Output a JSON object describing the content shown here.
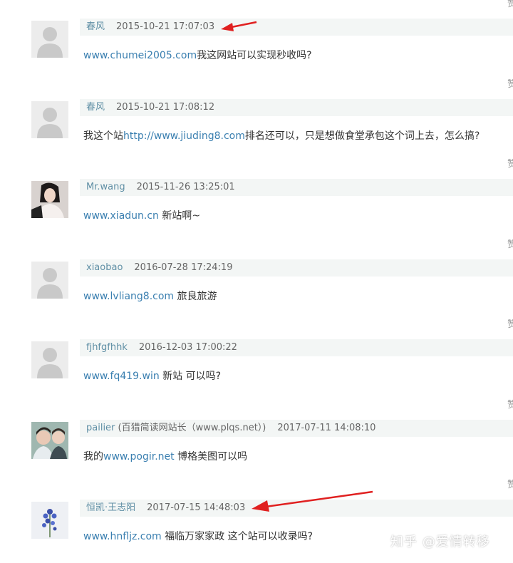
{
  "reply_label": "赞",
  "comments": [
    {
      "user": "春风",
      "note": "",
      "time": "2015-10-21 17:07:03",
      "pre": "",
      "link": "www.chumei2005.com",
      "post": "我这网站可以实现秒收吗?",
      "avatar": "default-avatar"
    },
    {
      "user": "春风",
      "note": "",
      "time": "2015-10-21 17:08:12",
      "pre": "我这个站",
      "link": "http://www.jiuding8.com",
      "post": "排名还可以，只是想做食堂承包这个词上去，怎么搞?",
      "avatar": "default-avatar"
    },
    {
      "user": "Mr.wang",
      "note": "",
      "time": "2015-11-26 13:25:01",
      "pre": "",
      "link": "www.xiadun.cn",
      "post": " 新站啊~",
      "avatar": "photo-avatar-woman"
    },
    {
      "user": "xiaobao",
      "note": "",
      "time": "2016-07-28 17:24:19",
      "pre": "",
      "link": "www.lvliang8.com",
      "post": " 旅良旅游",
      "avatar": "default-avatar"
    },
    {
      "user": "fjhfgfhhk",
      "note": "",
      "time": "2016-12-03 17:00:22",
      "pre": "",
      "link": "www.fq419.win",
      "post": " 新站 可以吗?",
      "avatar": "default-avatar"
    },
    {
      "user": "pailier",
      "note": " (百猎简读网站长（www.plqs.net）)",
      "time": "2017-07-11 14:08:10",
      "pre": "我的",
      "link": "www.pogir.net",
      "post": " 博格美图可以吗",
      "avatar": "photo-avatar-couple"
    },
    {
      "user": "恒凯·王志阳",
      "note": "",
      "time": "2017-07-15 14:48:03",
      "pre": "",
      "link": "www.hnfljz.com",
      "post": " 福临万家家政 这个站可以收录吗?",
      "avatar": "flower-avatar"
    }
  ],
  "watermark": "知乎 @爱情转移",
  "colors": {
    "link": "#3a7fb0",
    "username": "#5f8fa5",
    "meta_bg": "#f3f6f5",
    "arrow": "#e02020"
  }
}
